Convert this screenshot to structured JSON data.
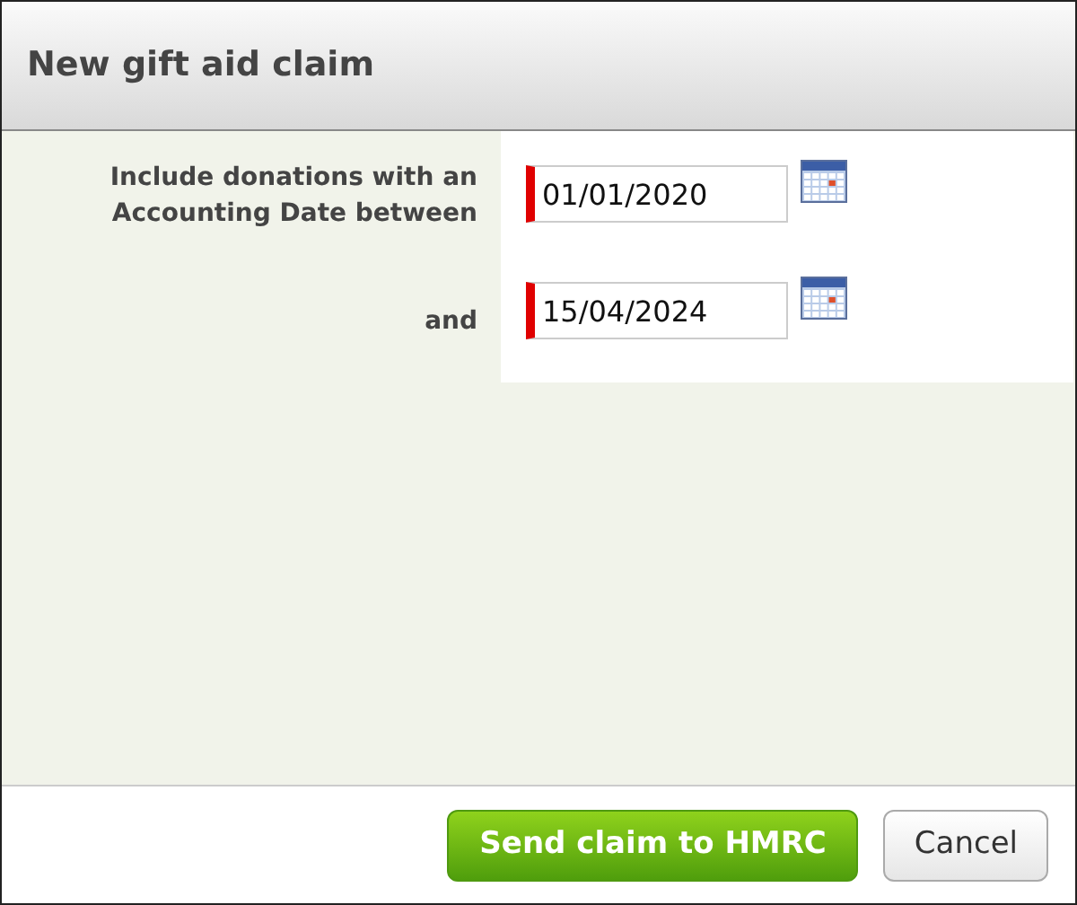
{
  "dialog": {
    "title": "New gift aid claim"
  },
  "fields": [
    {
      "label": "Include donations with an Accounting Date between",
      "value": "01/01/2020",
      "required": true
    },
    {
      "label": "and",
      "value": "15/04/2024",
      "required": true
    }
  ],
  "buttons": [
    {
      "label": "Send claim to HMRC",
      "kind": "primary"
    },
    {
      "label": "Cancel",
      "kind": "secondary"
    }
  ]
}
